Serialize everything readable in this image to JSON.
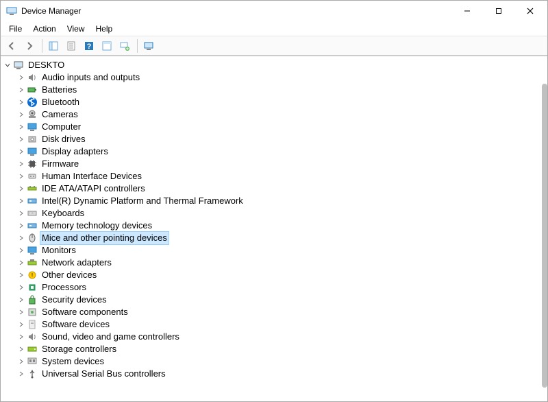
{
  "window": {
    "title": "Device Manager"
  },
  "menu": {
    "file": "File",
    "action": "Action",
    "view": "View",
    "help": "Help"
  },
  "tree": {
    "root": {
      "label": "DESKTO"
    },
    "items": [
      {
        "id": "audio",
        "label": "Audio inputs and outputs",
        "icon": "speaker"
      },
      {
        "id": "batteries",
        "label": "Batteries",
        "icon": "battery"
      },
      {
        "id": "bluetooth",
        "label": "Bluetooth",
        "icon": "bluetooth"
      },
      {
        "id": "cameras",
        "label": "Cameras",
        "icon": "camera"
      },
      {
        "id": "computer",
        "label": "Computer",
        "icon": "monitor"
      },
      {
        "id": "disk",
        "label": "Disk drives",
        "icon": "disk"
      },
      {
        "id": "display",
        "label": "Display adapters",
        "icon": "monitor"
      },
      {
        "id": "firmware",
        "label": "Firmware",
        "icon": "chip"
      },
      {
        "id": "hid",
        "label": "Human Interface Devices",
        "icon": "hid"
      },
      {
        "id": "ide",
        "label": "IDE ATA/ATAPI controllers",
        "icon": "ide"
      },
      {
        "id": "intel",
        "label": "Intel(R) Dynamic Platform and Thermal Framework",
        "icon": "card"
      },
      {
        "id": "keyboards",
        "label": "Keyboards",
        "icon": "keyboard"
      },
      {
        "id": "memory",
        "label": "Memory technology devices",
        "icon": "card"
      },
      {
        "id": "mice",
        "label": "Mice and other pointing devices",
        "icon": "mouse",
        "selected": true
      },
      {
        "id": "monitors",
        "label": "Monitors",
        "icon": "monitor"
      },
      {
        "id": "network",
        "label": "Network adapters",
        "icon": "network"
      },
      {
        "id": "other",
        "label": "Other devices",
        "icon": "other"
      },
      {
        "id": "processors",
        "label": "Processors",
        "icon": "cpu"
      },
      {
        "id": "security",
        "label": "Security devices",
        "icon": "security"
      },
      {
        "id": "softcomp",
        "label": "Software components",
        "icon": "softcomp"
      },
      {
        "id": "softdev",
        "label": "Software devices",
        "icon": "softdev"
      },
      {
        "id": "sound",
        "label": "Sound, video and game controllers",
        "icon": "speaker"
      },
      {
        "id": "storage",
        "label": "Storage controllers",
        "icon": "storage"
      },
      {
        "id": "system",
        "label": "System devices",
        "icon": "system"
      },
      {
        "id": "usb",
        "label": "Universal Serial Bus controllers",
        "icon": "usb"
      }
    ]
  }
}
